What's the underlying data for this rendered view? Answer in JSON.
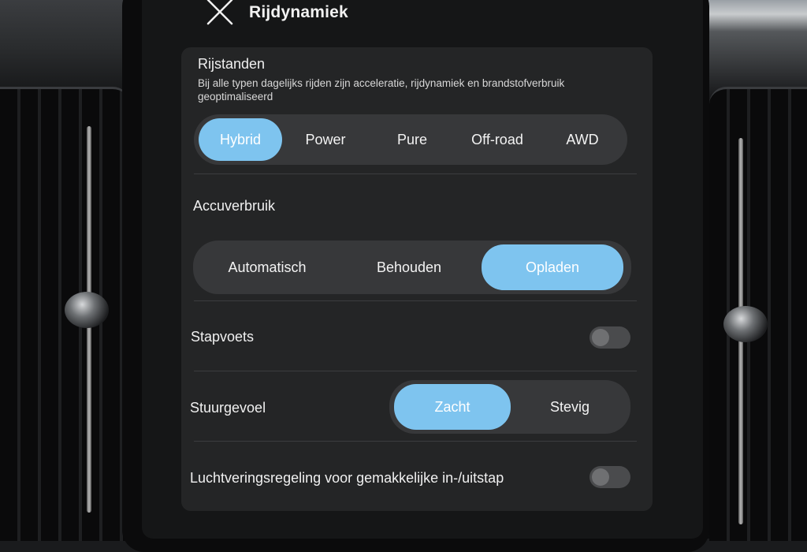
{
  "header": {
    "title": "Rijdynamiek"
  },
  "drive_modes": {
    "title": "Rijstanden",
    "description": "Bij alle typen dagelijks rijden zijn acceleratie, rijdynamiek en brandstofverbruik geoptimaliseerd",
    "options": [
      "Hybrid",
      "Power",
      "Pure",
      "Off-road",
      "AWD"
    ],
    "selected": "Hybrid"
  },
  "battery_usage": {
    "title": "Accuverbruik",
    "options": [
      "Automatisch",
      "Behouden",
      "Opladen"
    ],
    "selected": "Opladen"
  },
  "creep": {
    "label": "Stapvoets",
    "enabled": false
  },
  "steering_feel": {
    "label": "Stuurgevoel",
    "options": [
      "Zacht",
      "Stevig"
    ],
    "selected": "Zacht"
  },
  "air_suspension": {
    "label": "Luchtveringsregeling voor gemakkelijke in-/uitstap",
    "enabled": false
  },
  "colors": {
    "accent": "#7ec4ef",
    "panel": "#242526",
    "background": "#151617"
  }
}
